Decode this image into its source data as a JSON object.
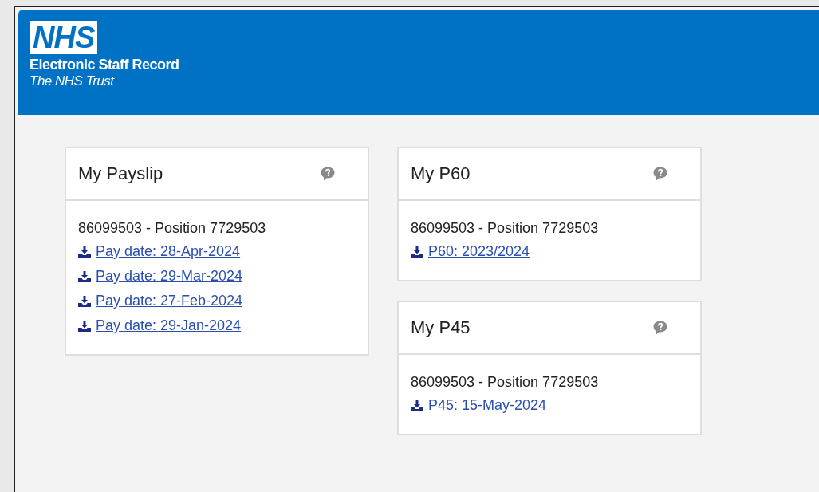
{
  "header": {
    "logo": "NHS",
    "title": "Electronic Staff Record",
    "subtitle": "The NHS Trust"
  },
  "columns": [
    {
      "cards": [
        {
          "title": "My Payslip",
          "position": "86099503 - Position 7729503",
          "links": [
            "Pay date: 28-Apr-2024",
            "Pay date: 29-Mar-2024",
            "Pay date: 27-Feb-2024",
            "Pay date: 29-Jan-2024"
          ]
        }
      ]
    },
    {
      "cards": [
        {
          "title": "My P60",
          "position": "86099503 - Position 7729503",
          "links": [
            "P60: 2023/2024"
          ]
        },
        {
          "title": "My P45",
          "position": "86099503 - Position 7729503",
          "links": [
            "P45: 15-May-2024"
          ]
        }
      ]
    }
  ]
}
